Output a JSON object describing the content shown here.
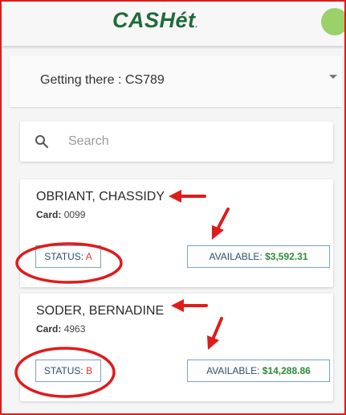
{
  "app": {
    "logo": "CASHét",
    "logo_suffix": "."
  },
  "program_select": {
    "value": "Getting there : CS789"
  },
  "search": {
    "placeholder": "Search"
  },
  "cards": [
    {
      "name": "OBRIANT, CHASSIDY",
      "card_label": "Card:",
      "card_number": "0099",
      "status_label": "STATUS:",
      "status_value": "A",
      "available_label": "AVAILABLE:",
      "available_value": "$3,592.31"
    },
    {
      "name": "SODER, BERNADINE",
      "card_label": "Card:",
      "card_number": "4963",
      "status_label": "STATUS:",
      "status_value": "B",
      "available_label": "AVAILABLE:",
      "available_value": "$14,288.86"
    }
  ],
  "colors": {
    "frame_border": "#e01b1b",
    "logo": "#1f6b3a",
    "status_value": "#e0372b",
    "available_value": "#2e8b3a",
    "annotation": "#e01b1b"
  }
}
